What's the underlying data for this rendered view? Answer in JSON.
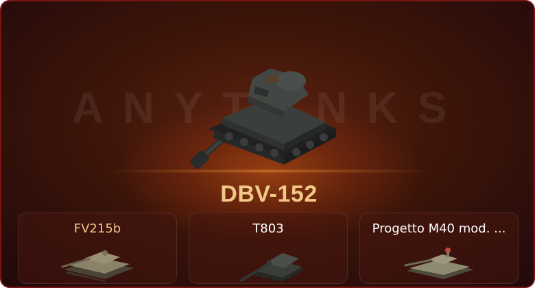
{
  "watermark": "ANYTANKS",
  "featured": {
    "name": "DBV-152",
    "icon": "heavy-tank-icon"
  },
  "slots": [
    {
      "name": "FV215b",
      "name_color": "#f2c889",
      "icon": "tank-icon"
    },
    {
      "name": "T803",
      "name_color": "#ffffff",
      "icon": "tank-destroyer-icon"
    },
    {
      "name": "Progetto M40 mod. ...",
      "name_color": "#ffffff",
      "icon": "medium-tank-icon"
    }
  ],
  "colors": {
    "accent_gold": "#f2c889",
    "border": "#7a1414"
  }
}
